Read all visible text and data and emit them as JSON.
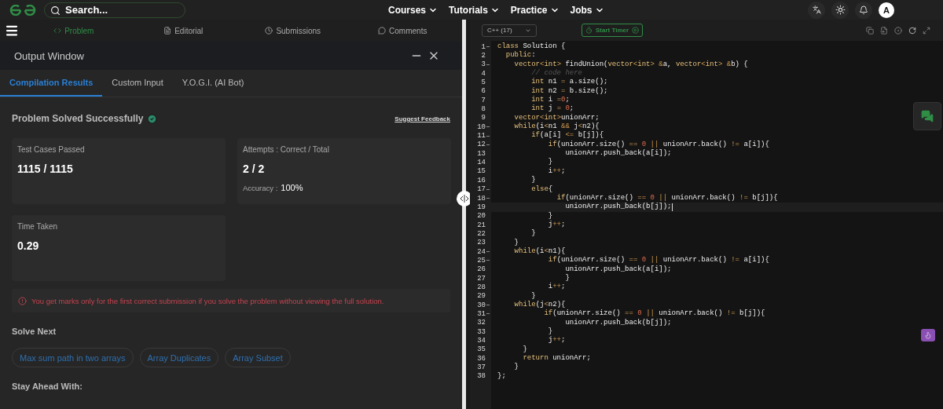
{
  "nav": {
    "search_placeholder": "Search...",
    "menus": [
      "Courses",
      "Tutorials",
      "Practice",
      "Jobs"
    ],
    "avatar": "A"
  },
  "problem_tabs": [
    {
      "label": "Problem",
      "selected": true
    },
    {
      "label": "Editorial",
      "selected": false
    },
    {
      "label": "Submissions",
      "selected": false
    },
    {
      "label": "Comments",
      "selected": false
    }
  ],
  "output_window": {
    "title": "Output Window",
    "tabs": [
      {
        "label": "Compilation Results",
        "selected": true
      },
      {
        "label": "Custom Input",
        "selected": false
      },
      {
        "label": "Y.O.G.I. (AI Bot)",
        "selected": false
      }
    ],
    "status": "Problem Solved Successfully",
    "feedback_link": "Suggest Feedback",
    "cards": [
      {
        "label": "Test Cases Passed",
        "value": "1115 / 1115"
      },
      {
        "label": "Attempts : Correct / Total",
        "value": "2 / 2",
        "sub_label": "Accuracy :",
        "sub_value": "100%"
      },
      {
        "label": "Time Taken",
        "value": "0.29"
      }
    ],
    "warning": "You get marks only for the first correct submission if you solve the problem without viewing the full solution.",
    "solve_next_heading": "Solve Next",
    "solve_next": [
      "Max sum path in two arrays",
      "Array Duplicates",
      "Array Subset"
    ],
    "stay_ahead_heading": "Stay Ahead With:"
  },
  "editor": {
    "language": "C++ (17)",
    "timer_button": "Start Timer",
    "lines": [
      {
        "n": "1",
        "text": "class Solution {",
        "fold": true,
        "active": false
      },
      {
        "n": "2",
        "text": "  public:",
        "fold": false,
        "active": false
      },
      {
        "n": "3",
        "text": "    vector<int> findUnion(vector<int> &a, vector<int> &b) {",
        "fold": true,
        "active": false
      },
      {
        "n": "4",
        "text": "        // code here",
        "fold": false,
        "active": false
      },
      {
        "n": "5",
        "text": "        int n1 = a.size();",
        "fold": false,
        "active": false
      },
      {
        "n": "6",
        "text": "        int n2 = b.size();",
        "fold": false,
        "active": false
      },
      {
        "n": "7",
        "text": "        int i =0;",
        "fold": false,
        "active": false
      },
      {
        "n": "8",
        "text": "        int j = 0;",
        "fold": false,
        "active": false
      },
      {
        "n": "9",
        "text": "    vector<int>unionArr;",
        "fold": false,
        "active": false
      },
      {
        "n": "10",
        "text": "    while(i<n1 && j<n2){",
        "fold": true,
        "active": false
      },
      {
        "n": "11",
        "text": "        if(a[i] <= b[j]){",
        "fold": true,
        "active": false
      },
      {
        "n": "12",
        "text": "            if(unionArr.size() == 0 || unionArr.back() != a[i]){",
        "fold": true,
        "active": false
      },
      {
        "n": "13",
        "text": "                unionArr.push_back(a[i]);",
        "fold": false,
        "active": false
      },
      {
        "n": "14",
        "text": "            }",
        "fold": false,
        "active": false
      },
      {
        "n": "15",
        "text": "            i++;",
        "fold": false,
        "active": false
      },
      {
        "n": "16",
        "text": "        }",
        "fold": false,
        "active": false
      },
      {
        "n": "17",
        "text": "        else{",
        "fold": true,
        "active": false
      },
      {
        "n": "18",
        "text": "              if(unionArr.size() == 0 || unionArr.back() != b[j]){",
        "fold": true,
        "active": false
      },
      {
        "n": "19",
        "text": "                unionArr.push_back(b[j]);",
        "fold": false,
        "active": true
      },
      {
        "n": "20",
        "text": "            }",
        "fold": false,
        "active": false
      },
      {
        "n": "21",
        "text": "            j++;",
        "fold": false,
        "active": false
      },
      {
        "n": "22",
        "text": "        }",
        "fold": false,
        "active": false
      },
      {
        "n": "23",
        "text": "    }",
        "fold": false,
        "active": false
      },
      {
        "n": "24",
        "text": "    while(i<n1){",
        "fold": true,
        "active": false
      },
      {
        "n": "25",
        "text": "            if(unionArr.size() == 0 || unionArr.back() != a[i]){",
        "fold": true,
        "active": false
      },
      {
        "n": "26",
        "text": "                unionArr.push_back(a[i]);",
        "fold": false,
        "active": false
      },
      {
        "n": "27",
        "text": "                }",
        "fold": false,
        "active": false
      },
      {
        "n": "28",
        "text": "            i++;",
        "fold": false,
        "active": false
      },
      {
        "n": "29",
        "text": "        }",
        "fold": false,
        "active": false
      },
      {
        "n": "30",
        "text": "    while(j<n2){",
        "fold": true,
        "active": false
      },
      {
        "n": "31",
        "text": "           if(unionArr.size() == 0 || unionArr.back() != b[j]){",
        "fold": true,
        "active": false
      },
      {
        "n": "32",
        "text": "                unionArr.push_back(b[j]);",
        "fold": false,
        "active": false
      },
      {
        "n": "33",
        "text": "            }",
        "fold": false,
        "active": false
      },
      {
        "n": "34",
        "text": "            j++;",
        "fold": false,
        "active": false
      },
      {
        "n": "35",
        "text": "      }",
        "fold": false,
        "active": false
      },
      {
        "n": "36",
        "text": "      return unionArr;",
        "fold": false,
        "active": false
      },
      {
        "n": "37",
        "text": "    }",
        "fold": false,
        "active": false
      },
      {
        "n": "38",
        "text": "};",
        "fold": false,
        "active": false
      }
    ]
  }
}
